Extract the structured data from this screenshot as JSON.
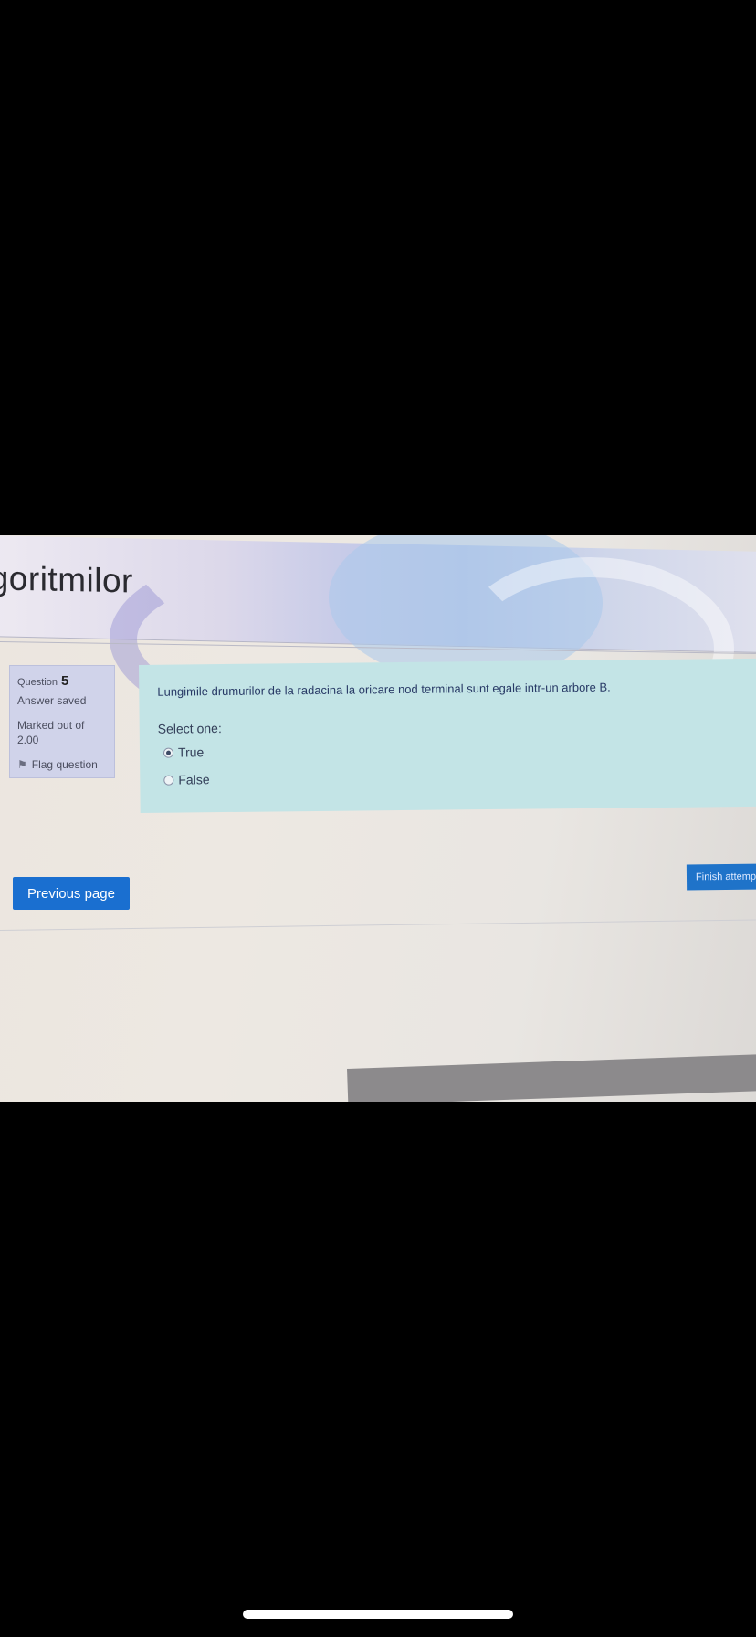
{
  "header": {
    "course_title": "lgoritmilor"
  },
  "question_info": {
    "label": "Question",
    "number": "5",
    "state": "Answer saved",
    "marked_label": "Marked out of",
    "marked_value": "2.00",
    "flag_label": "Flag question",
    "flag_icon": "flag-icon"
  },
  "question": {
    "text": "Lungimile drumurilor de la radacina la oricare nod terminal sunt egale intr-un arbore B.",
    "prompt": "Select one:",
    "options": [
      {
        "label": "True",
        "selected": true
      },
      {
        "label": "False",
        "selected": false
      }
    ]
  },
  "navigation": {
    "finish_label": "Finish attemp",
    "previous_label": "Previous page"
  },
  "colors": {
    "question_bg": "#c3e4e6",
    "info_bg": "#d0d3ea",
    "button_blue": "#1a6fd0"
  }
}
